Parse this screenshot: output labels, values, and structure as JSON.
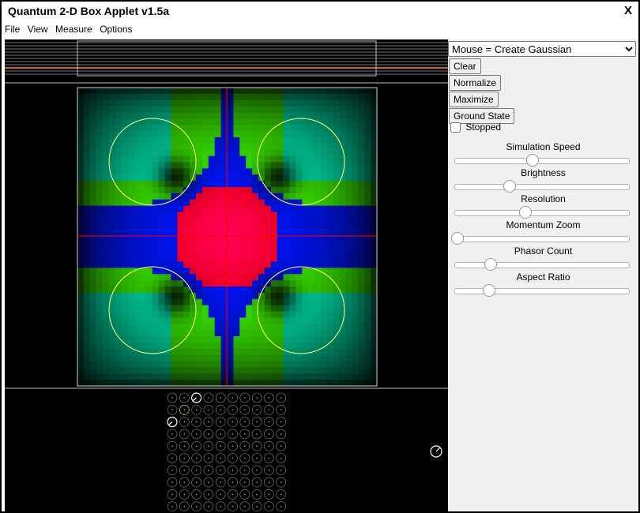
{
  "window": {
    "title": "Quantum 2-D Box Applet v1.5a",
    "close_label": "X"
  },
  "menu": [
    {
      "label": "File"
    },
    {
      "label": "View"
    },
    {
      "label": "Measure"
    },
    {
      "label": "Options"
    }
  ],
  "controls": {
    "mouse_mode": {
      "selected": "Mouse = Create Gaussian"
    },
    "buttons": [
      {
        "label": "Clear"
      },
      {
        "label": "Normalize"
      },
      {
        "label": "Maximize"
      },
      {
        "label": "Ground State"
      }
    ],
    "stopped": {
      "label": "Stopped",
      "checked": false
    },
    "sliders": [
      {
        "label": "Simulation Speed",
        "value": 0.44
      },
      {
        "label": "Brightness",
        "value": 0.31
      },
      {
        "label": "Resolution",
        "value": 0.4
      },
      {
        "label": "Momentum Zoom",
        "value": 0.01
      },
      {
        "label": "Phasor Count",
        "value": 0.2
      },
      {
        "label": "Aspect Ratio",
        "value": 0.19
      }
    ]
  },
  "colors": {
    "crosshair": "#ff0000",
    "circle": "#ffff80",
    "phasor": "#ffffff",
    "divider": "#808080",
    "bar_line": "#d06030"
  },
  "wavefunction": {
    "grid": 48,
    "circles": 4
  },
  "phasors": {
    "cols": 10,
    "rows": 10
  }
}
